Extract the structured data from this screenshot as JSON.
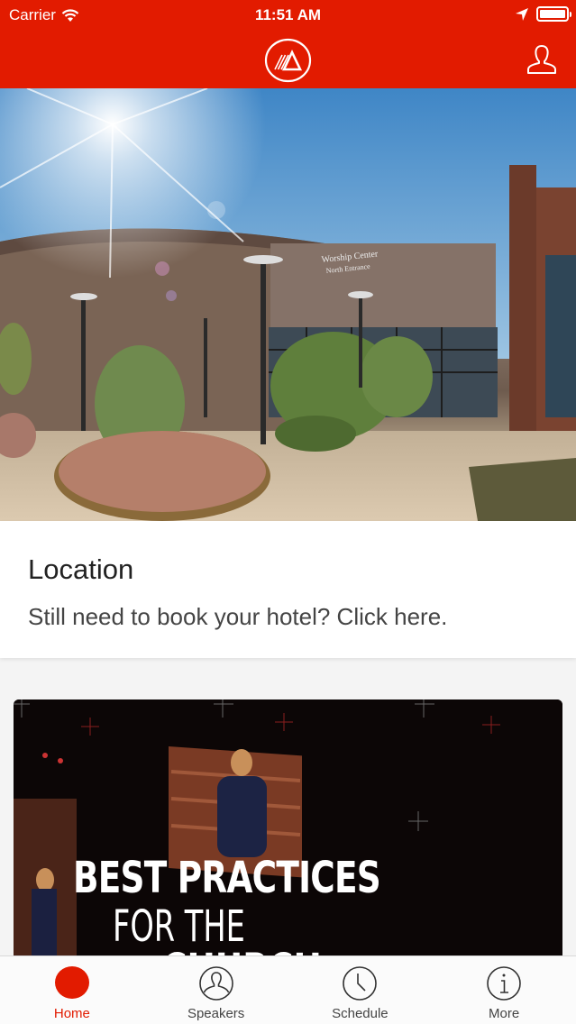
{
  "status_bar": {
    "carrier": "Carrier",
    "time": "11:51 AM",
    "wifi_icon": "wifi-icon",
    "location_icon": "location-arrow-icon",
    "battery_icon": "battery-full-icon"
  },
  "header": {
    "logo_icon": "mountain-logo-icon",
    "profile_icon": "user-icon",
    "background_color": "#e21b00"
  },
  "hero": {
    "sign_line1": "Worship Center",
    "sign_line2": "North Entrance"
  },
  "location_card": {
    "title": "Location",
    "subtitle": "Still need to book your hotel? Click here."
  },
  "video_card": {
    "line1": "BEST PRACTICES",
    "line2": "FOR THE",
    "line3": "CHURCH"
  },
  "tabbar": {
    "accent_color": "#e21b00",
    "tabs": [
      {
        "label": "Home",
        "icon": "home-dot-icon",
        "active": true
      },
      {
        "label": "Speakers",
        "icon": "person-circle-icon",
        "active": false
      },
      {
        "label": "Schedule",
        "icon": "clock-icon",
        "active": false
      },
      {
        "label": "More",
        "icon": "info-icon",
        "active": false
      }
    ]
  }
}
